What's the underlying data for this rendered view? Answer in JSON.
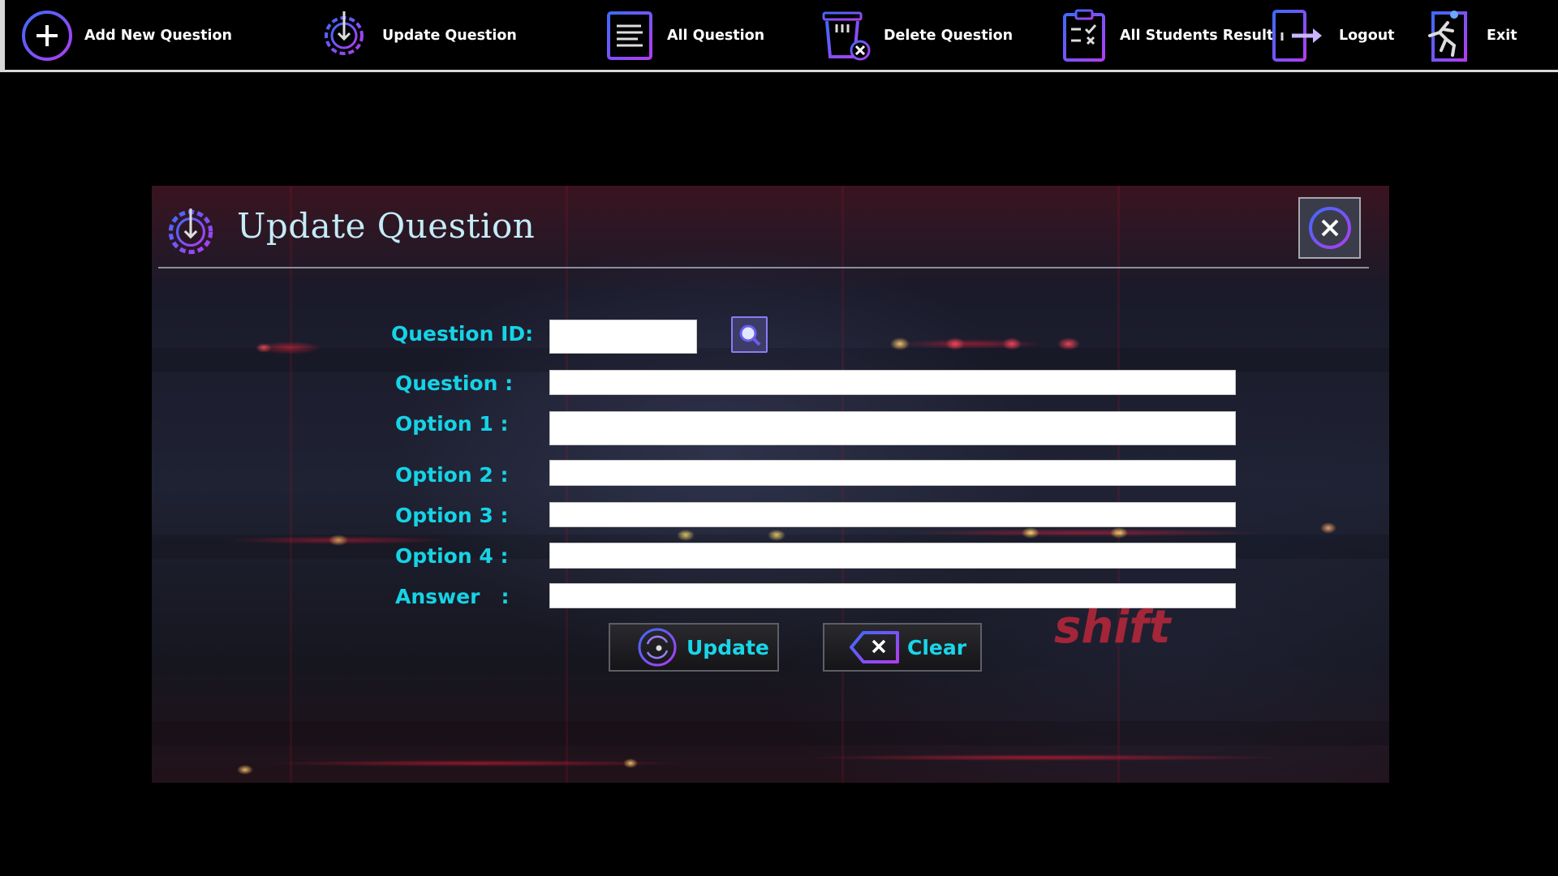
{
  "menu": {
    "items": [
      {
        "label": "Add New Question",
        "icon": "plus-circle-icon"
      },
      {
        "label": "Update Question",
        "icon": "gear-download-icon"
      },
      {
        "label": "All Question",
        "icon": "document-list-icon"
      },
      {
        "label": "Delete Question",
        "icon": "trash-x-icon"
      },
      {
        "label": "All Students Result",
        "icon": "clipboard-check-icon"
      },
      {
        "label": "Logout",
        "icon": "logout-door-icon"
      },
      {
        "label": "Exit",
        "icon": "running-exit-icon"
      }
    ]
  },
  "dialog": {
    "title": "Update Question",
    "title_icon": "gear-download-icon",
    "close_icon": "close-circle-icon",
    "background_text": "shift"
  },
  "form": {
    "question_id_label": "Question ID:",
    "question_label": "Question :",
    "option1_label": "Option 1 :",
    "option2_label": "Option 2 :",
    "option3_label": "Option 3 :",
    "option4_label": "Option 4 :",
    "answer_label": "Answer   :",
    "question_id_value": "",
    "question_value": "",
    "option1_value": "",
    "option2_value": "",
    "option3_value": "",
    "option4_value": "",
    "answer_value": "",
    "search_icon": "search-icon"
  },
  "buttons": {
    "update_label": "Update",
    "update_icon": "refresh-disc-icon",
    "clear_label": "Clear",
    "clear_icon": "backspace-x-icon"
  },
  "colors": {
    "accent_cyan": "#16d3e6",
    "icon_purple": "#7a4cf0",
    "title_color": "#c3ecf6"
  }
}
